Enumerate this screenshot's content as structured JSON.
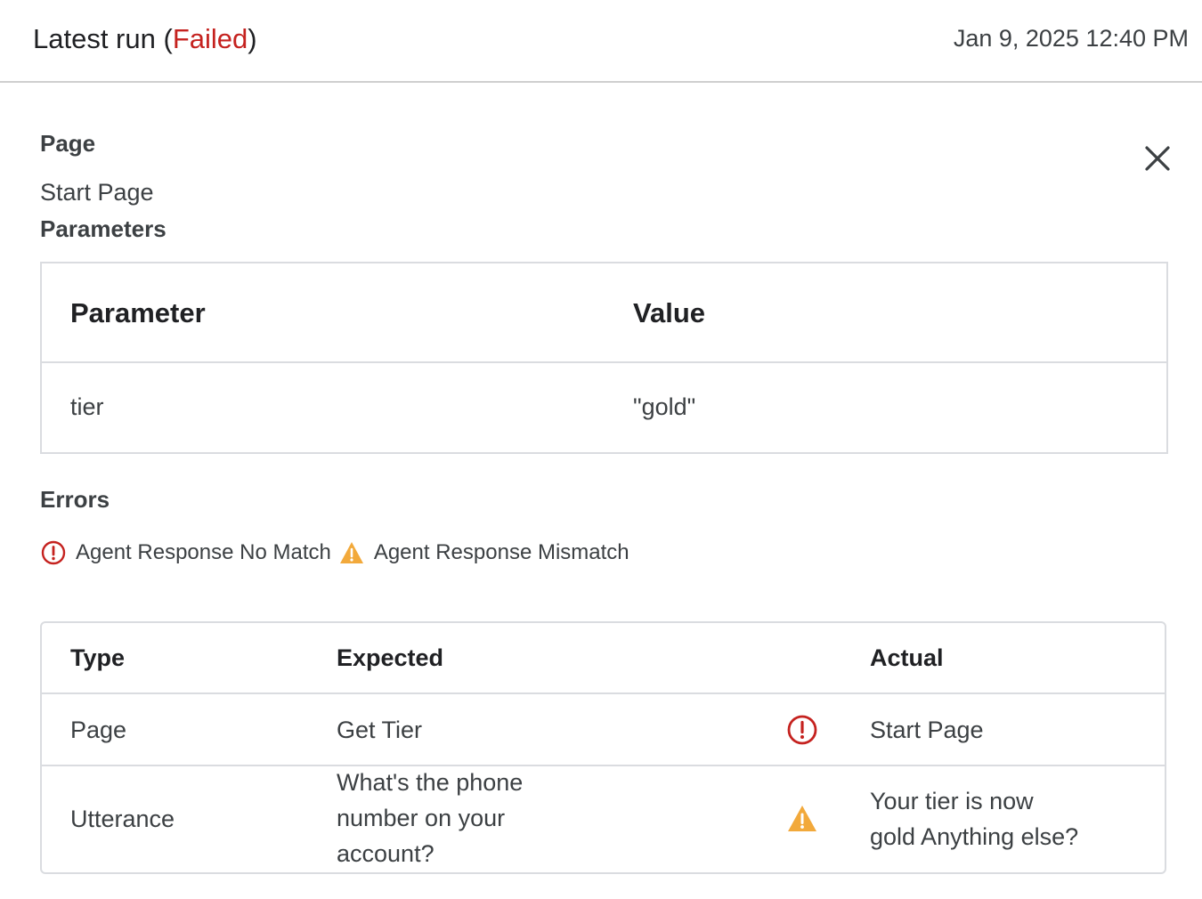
{
  "header": {
    "title_prefix": "Latest run (",
    "status": "Failed",
    "title_suffix": ")",
    "timestamp": "Jan 9, 2025 12:40 PM",
    "status_color": "#c5221f"
  },
  "close_icon": "close-icon",
  "page_section": {
    "label": "Page",
    "value": "Start Page"
  },
  "parameters_section": {
    "label": "Parameters",
    "columns": [
      "Parameter",
      "Value"
    ],
    "rows": [
      {
        "parameter": "tier",
        "value": "\"gold\""
      }
    ]
  },
  "errors_section": {
    "label": "Errors",
    "items": [
      {
        "icon": "error-circle-icon",
        "text": "Agent Response No Match"
      },
      {
        "icon": "warning-triangle-icon",
        "text": "Agent Response Mismatch"
      }
    ],
    "error_color": "#c5221f",
    "warning_color": "#f2a93b"
  },
  "results_table": {
    "columns": [
      "Type",
      "Expected",
      "Actual"
    ],
    "rows": [
      {
        "type": "Page",
        "expected": [
          "Get Tier"
        ],
        "status_icon": "error-circle-icon",
        "actual": [
          "Start Page"
        ]
      },
      {
        "type": "Utterance",
        "expected": [
          "What's the phone",
          "number on your",
          "account?"
        ],
        "status_icon": "warning-triangle-icon",
        "actual": [
          "Your tier is now",
          "gold Anything else?"
        ]
      }
    ]
  }
}
